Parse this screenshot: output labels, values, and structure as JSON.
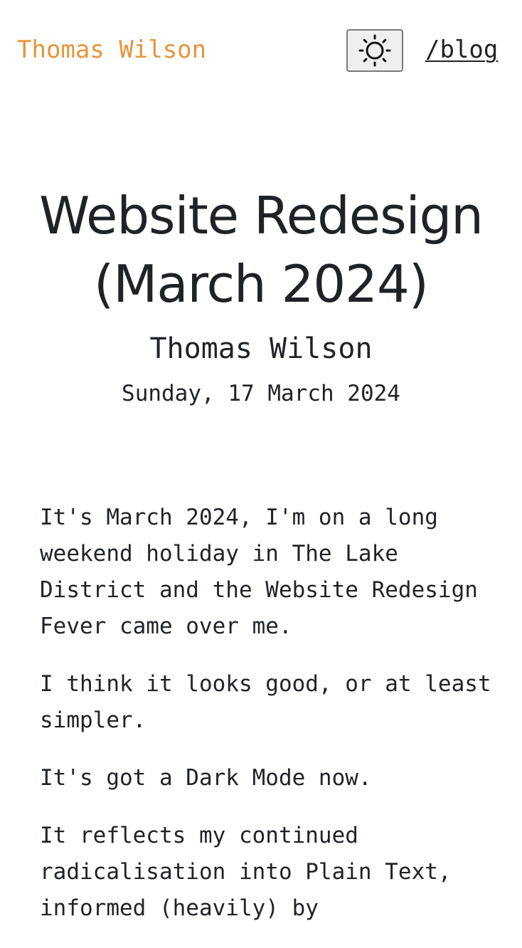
{
  "header": {
    "site_name": "Thomas Wilson",
    "theme_toggle_icon": "sun-icon",
    "nav_blog_label": "/blog"
  },
  "post": {
    "title": "Website Redesign (March 2024)",
    "author": "Thomas Wilson",
    "date": "Sunday, 17 March 2024",
    "paragraphs": [
      "It's March 2024, I'm on a long weekend holiday in The Lake District and the Website Redesign Fever came over me.",
      "I think it looks good, or at least simpler.",
      "It's got a Dark Mode now.",
      "It reflects my continued radicalisation into Plain Text, informed (heavily) by"
    ]
  },
  "colors": {
    "accent": "#e8943a",
    "text": "#1f2328",
    "background": "#ffffff",
    "toggle_bg": "#efefef",
    "toggle_border": "#7b7b7b"
  }
}
